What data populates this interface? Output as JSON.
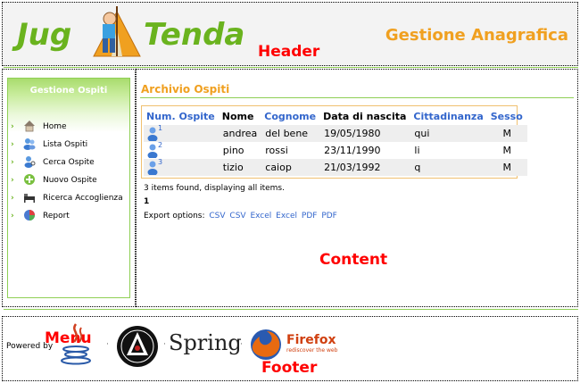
{
  "header": {
    "logo_left": "Jug",
    "logo_right": "Tenda",
    "subtitle": "Gestione Anagrafica",
    "region_label": "Header"
  },
  "menu": {
    "title": "Gestione Ospiti",
    "region_label": "Menu",
    "items": [
      {
        "label": "Home",
        "icon": "home-icon"
      },
      {
        "label": "Lista Ospiti",
        "icon": "users-icon"
      },
      {
        "label": "Cerca Ospite",
        "icon": "search-user-icon"
      },
      {
        "label": "Nuovo Ospite",
        "icon": "add-user-icon"
      },
      {
        "label": "Ricerca Accoglienza",
        "icon": "bed-icon"
      },
      {
        "label": "Report",
        "icon": "report-icon"
      }
    ]
  },
  "content": {
    "title": "Archivio Ospiti",
    "region_label": "Content",
    "columns": [
      "Num. Ospite",
      "Nome",
      "Cognome",
      "Data di nascita",
      "Cittadinanza",
      "Sesso"
    ],
    "rows": [
      {
        "num": "1",
        "nome": "andrea",
        "cognome": "del bene",
        "data": "19/05/1980",
        "cittadinanza": "qui",
        "sesso": "M"
      },
      {
        "num": "2",
        "nome": "pino",
        "cognome": "rossi",
        "data": "23/11/1990",
        "cittadinanza": "li",
        "sesso": "M"
      },
      {
        "num": "3",
        "nome": "tizio",
        "cognome": "caiop",
        "data": "21/03/1992",
        "cittadinanza": "q",
        "sesso": "M"
      }
    ],
    "status": "3 items found, displaying all items.",
    "pager": "1",
    "export_label": "Export options:",
    "export_options": [
      "CSV",
      "CSV",
      "Excel",
      "Excel",
      "PDF",
      "PDF"
    ]
  },
  "footer": {
    "powered_by": "Powered by",
    "spring": "Spring",
    "firefox_title": "Firefox",
    "firefox_sub": "rediscover the web",
    "region_label": "Footer"
  },
  "colors": {
    "accent_orange": "#f0a020",
    "green": "#6ab31e",
    "link_blue": "#3366cc",
    "label_red": "#ff0000"
  }
}
